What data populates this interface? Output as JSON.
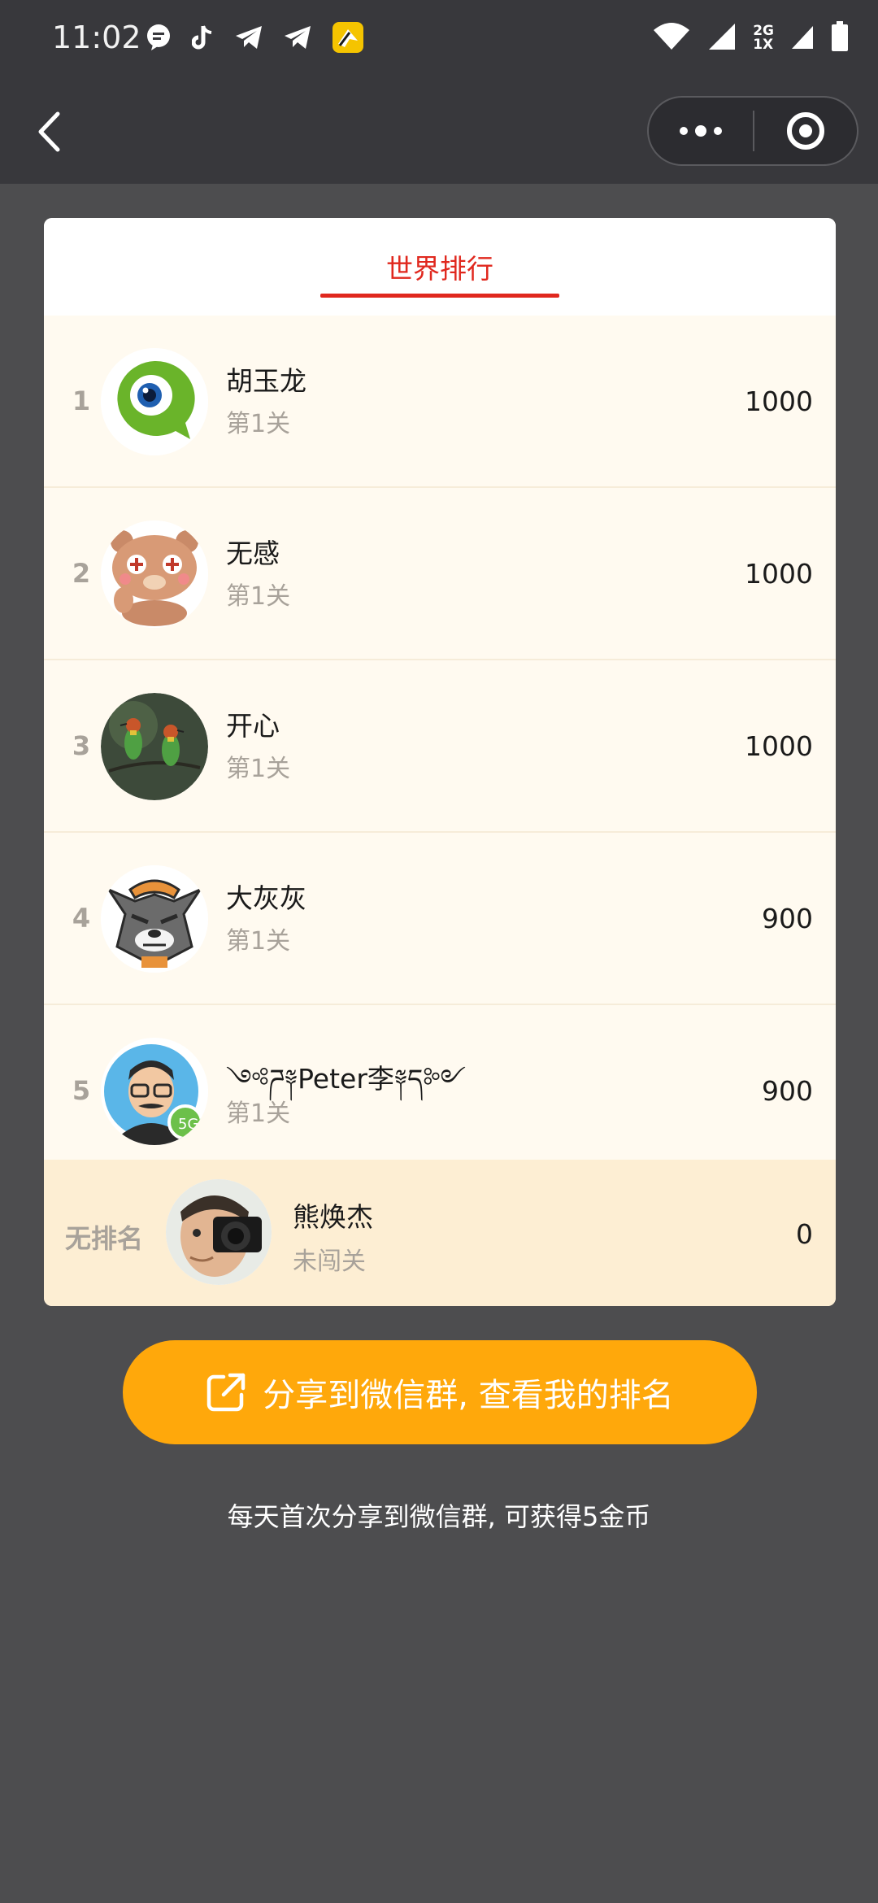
{
  "status_bar": {
    "time": "11:02",
    "network_top": "2G",
    "network_bottom": "1X",
    "icons_left": [
      "message-icon",
      "tiktok-icon",
      "telegram-icon",
      "telegram-icon",
      "app-icon"
    ],
    "icons_right": [
      "wifi-icon",
      "signal-icon",
      "signal-2-icon",
      "battery-icon"
    ]
  },
  "nav": {
    "back_icon": "chevron-left-icon",
    "more_icon": "more-dots-icon",
    "close_icon": "target-ring-icon"
  },
  "tab": {
    "title": "世界排行"
  },
  "ranking": [
    {
      "rank": "1",
      "name": "胡玉龙",
      "level": "第1关",
      "score": "1000",
      "avatar": "green-eye-avatar"
    },
    {
      "rank": "2",
      "name": "无感",
      "level": "第1关",
      "score": "1000",
      "avatar": "bear-avatar"
    },
    {
      "rank": "3",
      "name": "开心",
      "level": "第1关",
      "score": "1000",
      "avatar": "birds-avatar"
    },
    {
      "rank": "4",
      "name": "大灰灰",
      "level": "第1关",
      "score": "900",
      "avatar": "wolf-avatar"
    },
    {
      "rank": "5",
      "name": "༺ཌ༈Peter李༈ད༻",
      "level": "第1关",
      "score": "900",
      "avatar": "cartoon-man-avatar"
    }
  ],
  "self": {
    "rank": "无排名",
    "name": "熊焕杰",
    "level": "未闯关",
    "score": "0",
    "avatar": "camera-man-avatar"
  },
  "share": {
    "label": "分享到微信群, 查看我的排名",
    "icon": "share-external-icon"
  },
  "hint": "每天首次分享到微信群, 可获得5金币",
  "colors": {
    "accent_red": "#e0281e",
    "button_orange": "#ffa80b",
    "row_bg": "#fffaf0",
    "self_row_bg": "#fdeed3"
  }
}
